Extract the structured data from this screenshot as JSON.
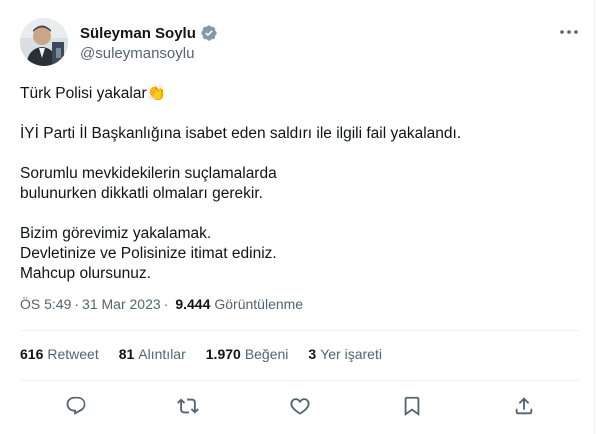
{
  "author": {
    "name": "Süleyman Soylu",
    "handle": "@suleymansoylu"
  },
  "tweet": {
    "first_line": "Türk Polisi yakalar",
    "emoji": "👏",
    "paragraphs": [
      [
        "İYİ Parti İl Başkanlığına isabet eden saldırı ile ilgili fail yakalandı."
      ],
      [
        "Sorumlu mevkidekilerin suçlamalarda",
        "bulunurken dikkatli olmaları gerekir."
      ],
      [
        "Bizim görevimiz yakalamak.",
        "Devletinize ve Polisinize itimat ediniz.",
        "Mahcup olursunuz."
      ]
    ]
  },
  "meta": {
    "time": "ÖS 5:49",
    "dot": "·",
    "date": "31 Mar 2023",
    "views_count": "9.444",
    "views_label": "Görüntülenme"
  },
  "stats": {
    "retweets": {
      "count": "616",
      "label": "Retweet"
    },
    "quotes": {
      "count": "81",
      "label": "Alıntılar"
    },
    "likes": {
      "count": "1.970",
      "label": "Beğeni"
    },
    "bookmarks": {
      "count": "3",
      "label": "Yer işareti"
    }
  },
  "icons": {
    "more": "more-icon",
    "verified": "verified-badge-icon",
    "reply": "reply-icon",
    "retweet": "retweet-icon",
    "like": "like-icon",
    "bookmark": "bookmark-icon",
    "share": "share-icon"
  },
  "colors": {
    "text": "#0f1419",
    "secondary": "#536471",
    "divider": "#eff3f4",
    "verified": "#829aab"
  }
}
